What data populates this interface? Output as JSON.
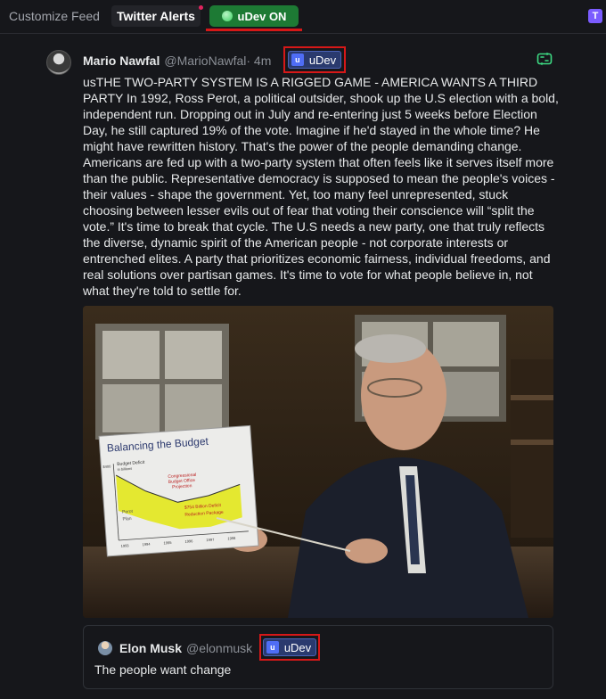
{
  "topbar": {
    "customize_feed": "Customize Feed",
    "twitter_alerts": "Twitter Alerts",
    "udev_on": "uDev ON",
    "app_icon": "T"
  },
  "post": {
    "author_name": "Mario Nawfal",
    "author_handle": "@MarioNawfal",
    "time": " · 4m",
    "badge_label": "uDev",
    "text": "usTHE TWO-PARTY SYSTEM IS A RIGGED GAME - AMERICA WANTS A THIRD PARTY In 1992, Ross Perot, a political outsider, shook up the U.S election with a bold, independent run. Dropping out in July and re-entering just 5 weeks before Election Day, he still captured 19% of the vote. Imagine if he'd stayed in the whole time? He might have rewritten history. That's the power of the people demanding change. Americans are fed up with a two-party system that often feels like it serves itself more than the public. Representative democracy is supposed to mean the people's voices - their values - shape the government. Yet, too many feel unrepresented, stuck choosing between lesser evils out of fear that voting their conscience will “split the vote.” It's time to break that cycle. The U.S needs a new party, one that truly reflects the diverse, dynamic spirit of the American people - not corporate interests or entrenched elites. A party that prioritizes economic fairness, individual freedoms, and real solutions over partisan games. It's time to vote for what people believe in, not what they're told to settle for.",
    "image": {
      "chart_title": "Balancing the Budget",
      "chart_sub_1": "Budget Deficit",
      "chart_sub_2": "in billions",
      "chart_label_1": "Congressional",
      "chart_label_2": "Budget Office",
      "chart_label_3": "Projection",
      "chart_label_4": "Perot",
      "chart_label_5": "Plan",
      "chart_label_6": "$754 Billion Deficit",
      "chart_label_7": "Reduction Package",
      "chart_y_top": "$400",
      "chart_years": [
        "1993",
        "1994",
        "1995",
        "1996",
        "1997",
        "1998"
      ]
    }
  },
  "quote": {
    "author_name": "Elon Musk",
    "author_handle": "@elonmusk",
    "badge_label": "uDev",
    "text": "The people want change"
  },
  "icons": {
    "status_dot": "green-dot-icon",
    "retweet": "retweet-icon",
    "udev_logo": "udev-logo-icon"
  },
  "colors": {
    "background": "#16171b",
    "udev_on_green": "#1d7a34",
    "highlight_red": "#d61818",
    "badge_blue": "#2a3a6e",
    "retweet_green": "#3ddc84"
  }
}
